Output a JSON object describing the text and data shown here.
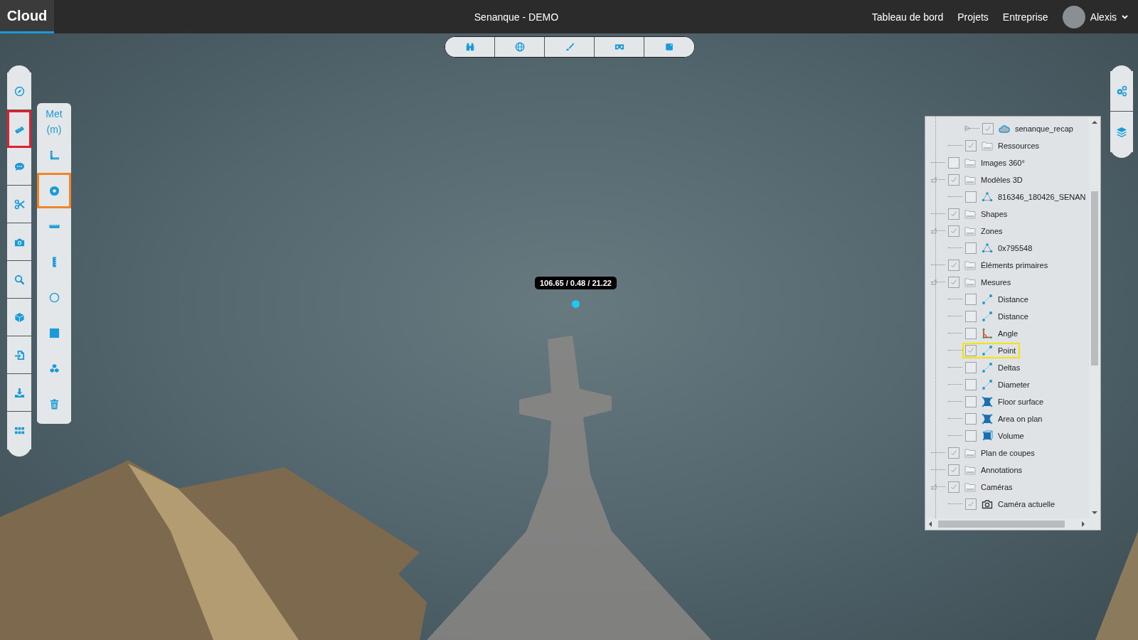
{
  "header": {
    "logo": "Cloud",
    "title": "Senanque - DEMO",
    "nav": [
      {
        "label": "Tableau de bord"
      },
      {
        "label": "Projets"
      },
      {
        "label": "Entreprise"
      }
    ],
    "user": {
      "name": "Alexis"
    }
  },
  "view_toolbar": [
    {
      "selected": false
    },
    {
      "selected": false
    },
    {
      "selected": false
    },
    {
      "selected": false
    },
    {
      "selected": false
    }
  ],
  "left_toolbar": [
    {
      "selected": false
    },
    {
      "selected": true
    },
    {
      "selected": false
    },
    {
      "selected": false
    },
    {
      "selected": false
    },
    {
      "selected": false
    },
    {
      "selected": false
    },
    {
      "selected": false
    },
    {
      "selected": false
    },
    {
      "selected": false
    }
  ],
  "measure_toolbar": {
    "unit": "Met (m)",
    "tools": [
      {
        "selected": false
      },
      {
        "selected": true
      },
      {
        "selected": false
      },
      {
        "selected": false
      },
      {
        "selected": false
      },
      {
        "selected": false
      },
      {
        "selected": false
      },
      {
        "selected": false
      }
    ]
  },
  "right_toolbar": [
    {
      "selected": false
    },
    {
      "selected": false
    }
  ],
  "point_label": "106.65 / 0.48 / 21.22",
  "tree": {
    "items": [
      {
        "children": [
          {
            "children": [
              {
                "label": "senanque_recap",
                "kind": "cloud",
                "checked": true,
                "selected": false,
                "expanded": false
              }
            ]
          },
          {
            "label": "Ressources",
            "kind": "folder",
            "checked": true,
            "selected": false
          }
        ]
      },
      {
        "label": "Images 360°",
        "kind": "folder",
        "checked": false,
        "selected": false
      },
      {
        "label": "Modèles 3D",
        "kind": "folder",
        "checked": true,
        "selected": false,
        "expanded": true,
        "children": [
          {
            "label": "816346_180426_SENAN",
            "kind": "mesh",
            "checked": false,
            "selected": false
          }
        ]
      },
      {
        "label": "Shapes",
        "kind": "folder",
        "checked": true,
        "selected": false
      },
      {
        "label": "Zones",
        "kind": "folder",
        "checked": true,
        "selected": false,
        "expanded": true,
        "children": [
          {
            "label": "0x795548",
            "kind": "mesh",
            "checked": false,
            "selected": false
          }
        ]
      },
      {
        "label": "Éléments primaires",
        "kind": "folder",
        "checked": true,
        "selected": false
      },
      {
        "label": "Mesures",
        "kind": "folder",
        "checked": true,
        "selected": false,
        "expanded": true,
        "children": [
          {
            "label": "Distance",
            "kind": "line",
            "checked": false,
            "selected": false
          },
          {
            "label": "Distance",
            "kind": "line",
            "checked": false,
            "selected": false
          },
          {
            "label": "Angle",
            "kind": "angle",
            "checked": false,
            "selected": false
          },
          {
            "label": "Point",
            "kind": "line",
            "checked": true,
            "selected": true
          },
          {
            "label": "Deltas",
            "kind": "line",
            "checked": false,
            "selected": false
          },
          {
            "label": "Diameter",
            "kind": "line",
            "checked": false,
            "selected": false
          },
          {
            "label": "Floor surface",
            "kind": "surface",
            "checked": false,
            "selected": false
          },
          {
            "label": "Area on plan",
            "kind": "surface",
            "checked": false,
            "selected": false
          },
          {
            "label": "Volume",
            "kind": "volume",
            "checked": false,
            "selected": false
          }
        ]
      },
      {
        "label": "Plan de coupes",
        "kind": "folder",
        "checked": true,
        "selected": false
      },
      {
        "label": "Annotations",
        "kind": "folder",
        "checked": true,
        "selected": false
      },
      {
        "label": "Caméras",
        "kind": "folder",
        "checked": true,
        "selected": false,
        "expanded": true,
        "children": [
          {
            "label": "Caméra actuelle",
            "kind": "camera",
            "checked": true,
            "selected": false
          }
        ]
      }
    ]
  }
}
